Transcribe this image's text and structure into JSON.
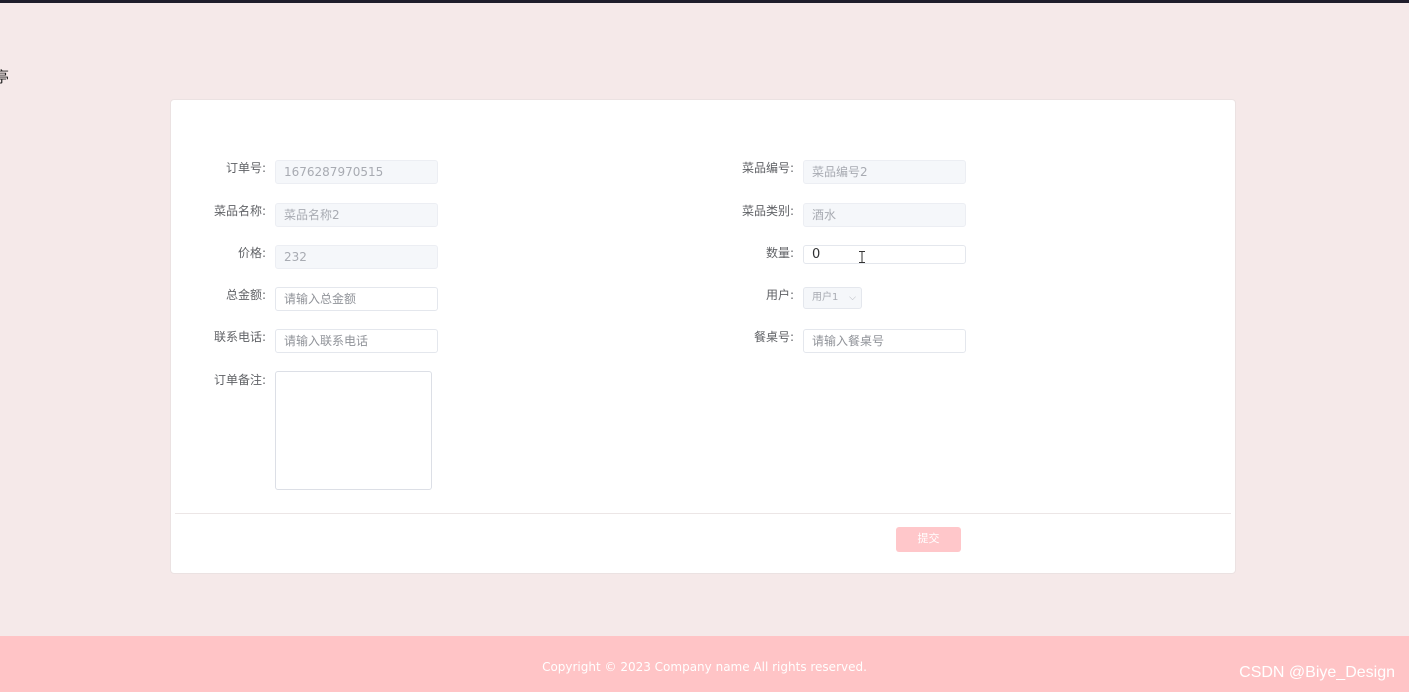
{
  "edge_char": "亭",
  "form": {
    "left": [
      {
        "label": "订单号:",
        "value": "1676287970515",
        "state": "disabled"
      },
      {
        "label": "菜品名称:",
        "value": "菜品名称2",
        "state": "disabled"
      },
      {
        "label": "价格:",
        "value": "232",
        "state": "disabled"
      },
      {
        "label": "总金额:",
        "value": "请输入总金额",
        "state": "placeholder"
      },
      {
        "label": "联系电话:",
        "value": "请输入联系电话",
        "state": "placeholder"
      }
    ],
    "right": [
      {
        "label": "菜品编号:",
        "value": "菜品编号2",
        "state": "disabled"
      },
      {
        "label": "菜品类别:",
        "value": "酒水",
        "state": "disabled"
      },
      {
        "label": "数量:",
        "value": "0",
        "state": "value"
      },
      {
        "label": "用户:",
        "value": "用户1",
        "state": "select"
      },
      {
        "label": "餐桌号:",
        "value": "请输入餐桌号",
        "state": "placeholder"
      }
    ],
    "remark_label": "订单备注:",
    "remark_value": ""
  },
  "submit_label": "提交",
  "footer_text": "Copyright © 2023 Company name All rights reserved.",
  "watermark": "CSDN @Biye_Design",
  "colors": {
    "background": "#f5e9e9",
    "accent": "#ffc4c6",
    "button": "#ffc7ca"
  }
}
